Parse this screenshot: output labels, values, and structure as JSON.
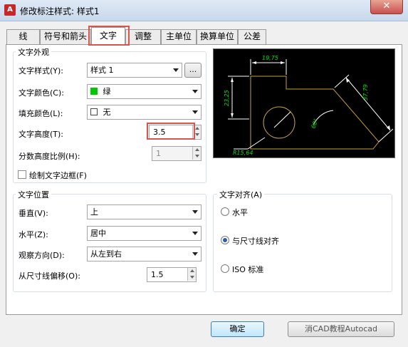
{
  "window": {
    "title": "修改标注样式: 样式1",
    "close_glyph": "✕"
  },
  "tabs": [
    "线",
    "符号和箭头",
    "文字",
    "调整",
    "主单位",
    "换算单位",
    "公差"
  ],
  "text_appearance": {
    "group_title": "文字外观",
    "style_label": "文字样式(Y):",
    "style_value": "样式 1",
    "style_more": "...",
    "color_label": "文字颜色(C):",
    "color_value": "绿",
    "color_swatch": "#00c800",
    "fill_label": "填充颜色(L):",
    "fill_value": "无",
    "height_label": "文字高度(T):",
    "height_value": "3.5",
    "fraction_label": "分数高度比例(H):",
    "fraction_value": "1",
    "frame_label": "绘制文字边框(F)"
  },
  "text_placement": {
    "group_title": "文字位置",
    "vertical_label": "垂直(V):",
    "vertical_value": "上",
    "horizontal_label": "水平(Z):",
    "horizontal_value": "居中",
    "view_label": "观察方向(D):",
    "view_value": "从左到右",
    "offset_label": "从尺寸线偏移(O):",
    "offset_value": "1.5"
  },
  "text_alignment": {
    "group_title": "文字对齐(A)",
    "options": [
      "水平",
      "与尺寸线对齐",
      "ISO 标准"
    ],
    "selected": "与尺寸线对齐"
  },
  "preview": {
    "dim_top": "19,75",
    "dim_left": "23,25",
    "dim_right": "37,79",
    "dim_angle": "60°",
    "dim_radius": "R15,64",
    "line_color": "#c8a040",
    "text_color": "#00e000"
  },
  "buttons": {
    "ok": "确定",
    "cancel": "消CAD教程Autocad"
  },
  "colors": {
    "highlight": "#d9534f"
  }
}
